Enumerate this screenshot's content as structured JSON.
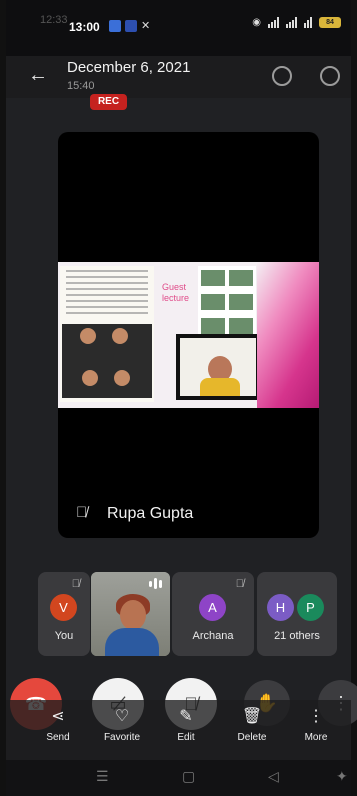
{
  "status_bar": {
    "ghost_time": "12:33",
    "time": "13:00",
    "battery": "84"
  },
  "header": {
    "title": "December 6, 2021",
    "subtitle": "15:40",
    "rec_label": "REC"
  },
  "main_tile": {
    "presenter_name": "Rupa Gupta",
    "slide_text": "Guest\nlecture"
  },
  "participants": [
    {
      "initial": "V",
      "label": "You",
      "color": "#d2461f"
    },
    {
      "initial": "A",
      "label": "Archana",
      "color": "#8e44c7"
    },
    {
      "initials": [
        "H",
        "P"
      ],
      "label": "21 others",
      "colors": [
        "#7b5cc5",
        "#1a8a5c"
      ]
    }
  ],
  "actions": [
    {
      "label": "Send",
      "icon": "share-icon"
    },
    {
      "label": "Favorite",
      "icon": "heart-icon"
    },
    {
      "label": "Edit",
      "icon": "pencil-icon"
    },
    {
      "label": "Delete",
      "icon": "trash-icon"
    },
    {
      "label": "More",
      "icon": "more-icon"
    }
  ],
  "colors": {
    "end_call": "#e5483d",
    "rec": "#c5221f",
    "background": "#202124"
  }
}
